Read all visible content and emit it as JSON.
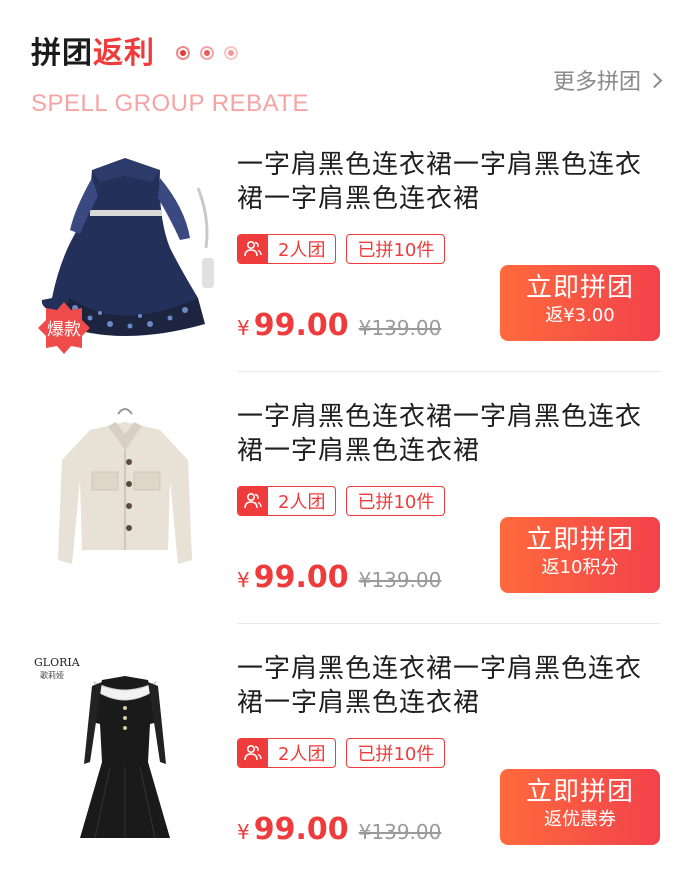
{
  "header": {
    "title_main": "拼团",
    "title_accent": "返利",
    "subtitle": "SPELL GROUP REBATE",
    "more_label": "更多拼团"
  },
  "items": [
    {
      "name": "一字肩黑色连衣裙一字肩黑色连衣裙一字肩黑色连衣裙",
      "badge": "爆款",
      "tag_group": "2人团",
      "tag_joined": "已拼10件",
      "currency": "¥",
      "price": "99.00",
      "old_price": "¥139.00",
      "button_label": "立即拼团",
      "button_sub": "返¥3.00"
    },
    {
      "name": "一字肩黑色连衣裙一字肩黑色连衣裙一字肩黑色连衣裙",
      "tag_group": "2人团",
      "tag_joined": "已拼10件",
      "currency": "¥",
      "price": "99.00",
      "old_price": "¥139.00",
      "button_label": "立即拼团",
      "button_sub": "返10积分"
    },
    {
      "name": "一字肩黑色连衣裙一字肩黑色连衣裙一字肩黑色连衣裙",
      "brand": "GLORIA",
      "brand_cn": "歌莉娅",
      "tag_group": "2人团",
      "tag_joined": "已拼10件",
      "currency": "¥",
      "price": "99.00",
      "old_price": "¥139.00",
      "button_label": "立即拼团",
      "button_sub": "返优惠券"
    }
  ],
  "colors": {
    "accent": "#ef3b3b",
    "subtitle": "#f6a3a3",
    "button_gradient_start": "#ff6a3d",
    "button_gradient_end": "#f2424b"
  },
  "icons": [
    "chevron-right-icon",
    "group-users-icon",
    "pagination-dot"
  ]
}
